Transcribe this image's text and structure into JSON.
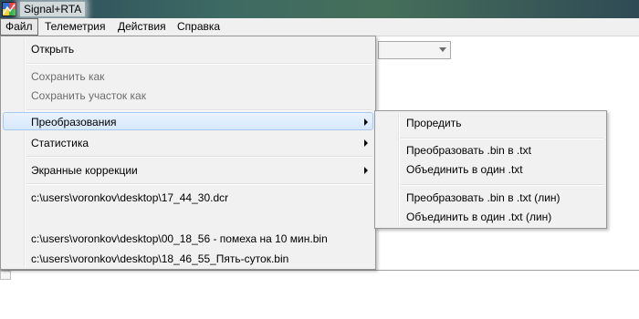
{
  "window": {
    "title": "Signal+RTA",
    "icon": "app-icon"
  },
  "menubar": {
    "items": [
      {
        "label": "Файл"
      },
      {
        "label": "Телеметрия"
      },
      {
        "label": "Действия"
      },
      {
        "label": "Справка"
      }
    ]
  },
  "file_menu": {
    "items": [
      {
        "label": "Открыть",
        "enabled": true
      },
      {
        "label": "Сохранить как",
        "enabled": false
      },
      {
        "label": "Сохранить участок как",
        "enabled": false
      },
      {
        "label": "Преобразования",
        "submenu": true,
        "highlighted": true
      },
      {
        "label": "Статистика",
        "submenu": true
      },
      {
        "label": "Экранные коррекции",
        "submenu": true
      },
      {
        "label": "c:\\users\\voronkov\\desktop\\17_44_30.dcr"
      },
      {
        "label": ""
      },
      {
        "label": "c:\\users\\voronkov\\desktop\\00_18_56 - помеха на 10 мин.bin"
      },
      {
        "label": "c:\\users\\voronkov\\desktop\\18_46_55_Пять-суток.bin"
      }
    ]
  },
  "transform_submenu": {
    "items": [
      {
        "label": "Проредить"
      },
      {
        "label": "Преобразовать .bin в .txt"
      },
      {
        "label": "Объединить в один .txt"
      },
      {
        "label": "Преобразовать .bin в .txt (лин)"
      },
      {
        "label": "Объединить в один .txt (лин)"
      }
    ]
  },
  "colors": {
    "menu_bg": "#f1f1f1",
    "highlight": "#d6e8fc",
    "disabled_text": "#6d6d6d"
  }
}
